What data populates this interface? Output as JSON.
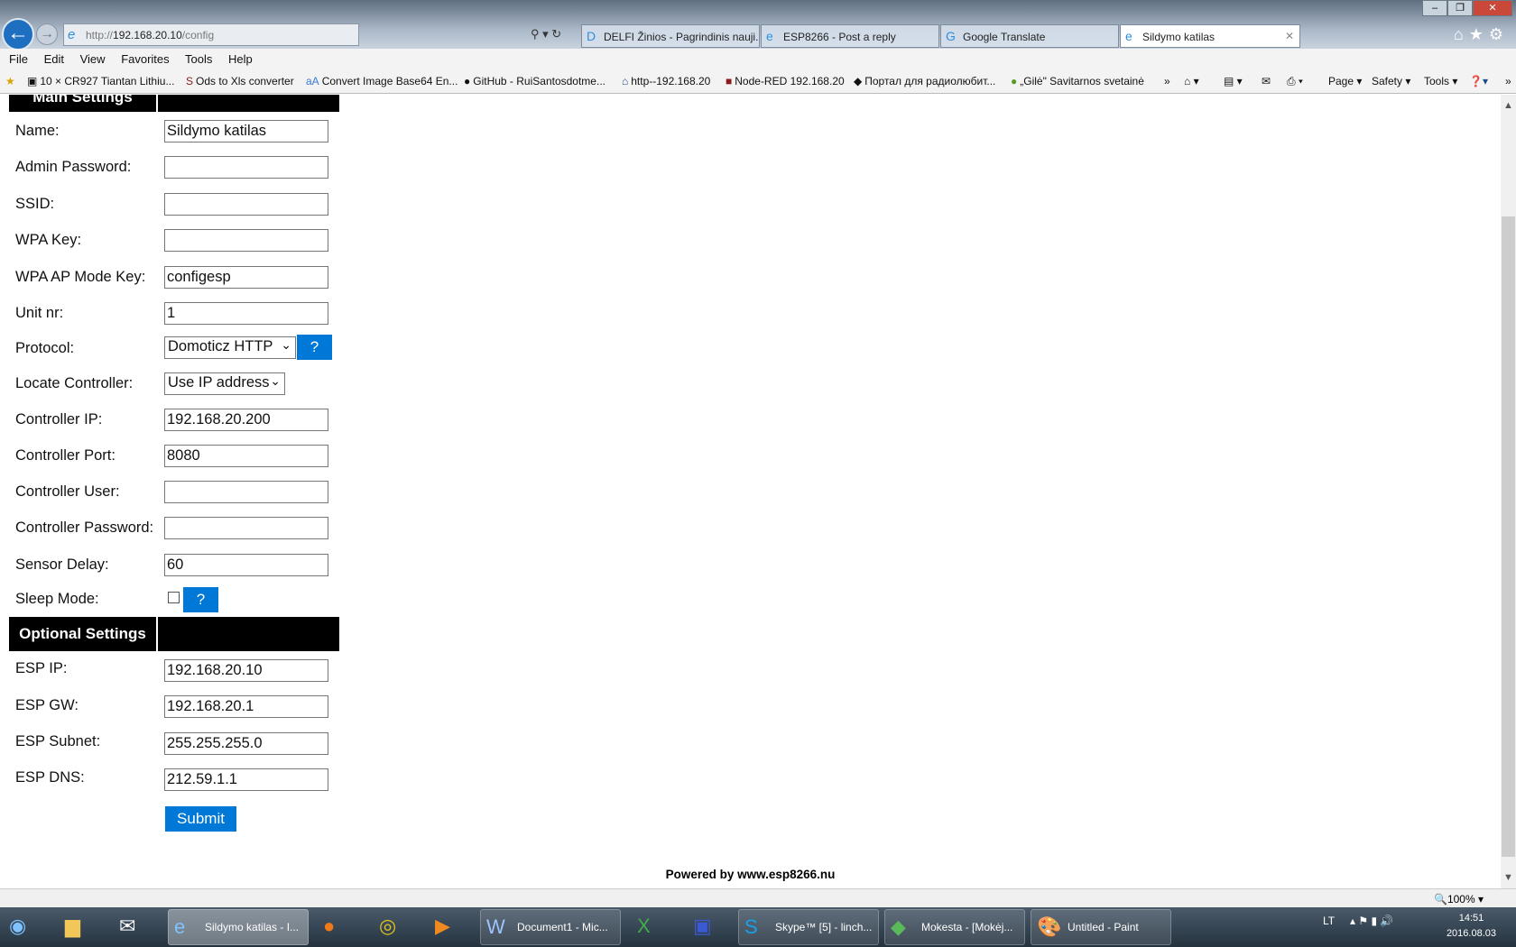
{
  "browser": {
    "address": {
      "prefix": "http://",
      "host": "192.168.20.10",
      "path": "/config"
    },
    "tabs": [
      {
        "label": "DELFI Žinios - Pagrindinis nauji...",
        "icon": "delfi-icon"
      },
      {
        "label": "ESP8266 - Post a reply",
        "icon": "ie-icon"
      },
      {
        "label": "Google Translate",
        "icon": "google-translate-icon"
      },
      {
        "label": "Sildymo katilas",
        "icon": "ie-icon",
        "active": true
      }
    ],
    "menu": [
      "File",
      "Edit",
      "View",
      "Favorites",
      "Tools",
      "Help"
    ],
    "favorites": [
      "10 × CR927 Tiantan Lithiu...",
      "Ods to Xls converter",
      "Convert Image Base64 En...",
      "GitHub - RuiSantosdotme...",
      "http--192.168.20",
      "Node-RED  192.168.20",
      "Портал для радиолюбит...",
      "„Gilė\" Savitarnos svetainė"
    ],
    "command_bar": {
      "page": "Page ▾",
      "safety": "Safety ▾",
      "tools": "Tools ▾"
    },
    "zoom": "100%"
  },
  "form": {
    "main_header": "Main Settings",
    "optional_header": "Optional Settings",
    "fields": [
      {
        "label": "Name:",
        "value": "Sildymo katilas"
      },
      {
        "label": "Admin Password:",
        "value": ""
      },
      {
        "label": "SSID:",
        "value": ""
      },
      {
        "label": "WPA Key:",
        "value": ""
      },
      {
        "label": "WPA AP Mode Key:",
        "value": "configesp"
      },
      {
        "label": "Unit nr:",
        "value": "1"
      }
    ],
    "protocol": {
      "label": "Protocol:",
      "value": "Domoticz HTTP",
      "help": "?"
    },
    "locate": {
      "label": "Locate Controller:",
      "value": "Use IP address"
    },
    "controller_fields": [
      {
        "label": "Controller IP:",
        "value": "192.168.20.200"
      },
      {
        "label": "Controller Port:",
        "value": "8080"
      },
      {
        "label": "Controller User:",
        "value": ""
      },
      {
        "label": "Controller Password:",
        "value": ""
      },
      {
        "label": "Sensor Delay:",
        "value": "60"
      }
    ],
    "sleep": {
      "label": "Sleep Mode:",
      "checked": false,
      "help": "?"
    },
    "optional_fields": [
      {
        "label": "ESP IP:",
        "value": "192.168.20.10"
      },
      {
        "label": "ESP GW:",
        "value": "192.168.20.1"
      },
      {
        "label": "ESP Subnet:",
        "value": "255.255.255.0"
      },
      {
        "label": "ESP DNS:",
        "value": "212.59.1.1"
      }
    ],
    "submit": "Submit",
    "footer": "Powered by www.esp8266.nu"
  },
  "taskbar": {
    "items": [
      {
        "label": "Sildymo katilas - I...",
        "active": true
      },
      {
        "label": "Document1 - Mic..."
      },
      {
        "label": "Skype™ [5] - linch..."
      },
      {
        "label": "Mokesta - [Mokėj..."
      },
      {
        "label": "Untitled - Paint"
      }
    ],
    "language": "LT",
    "time": "14:51",
    "date": "2016.08.03"
  }
}
